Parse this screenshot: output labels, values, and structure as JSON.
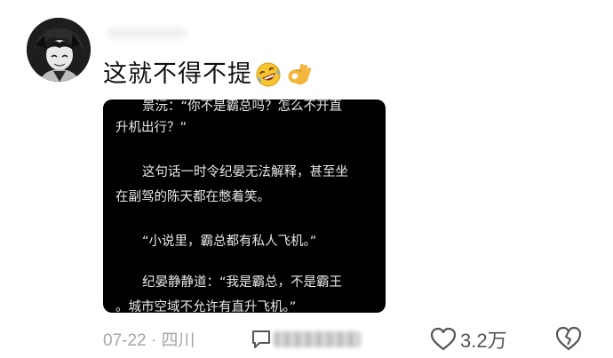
{
  "comment": {
    "text": "这就不得不提",
    "emojis": [
      "rofl-emoji-icon",
      "ok-hand-emoji-icon"
    ]
  },
  "screenshot": {
    "lines": [
      "景沅：“你不是霸总吗？怎么不开直",
      "升机出行？”",
      "这句话一时令纪晏无法解释，甚至坐",
      "在副驾的陈天都在憋着笑。",
      "“小说里，霸总都有私人飞机。”",
      "纪晏静静道：“我是霸总，不是霸王",
      "。城市空域不允许有直升飞机。”"
    ]
  },
  "footer": {
    "date": "07-22",
    "separator": "·",
    "location": "四川",
    "like_count": "3.2万",
    "icons": [
      "reply-icon",
      "heart-icon",
      "broken-heart-icon"
    ]
  }
}
